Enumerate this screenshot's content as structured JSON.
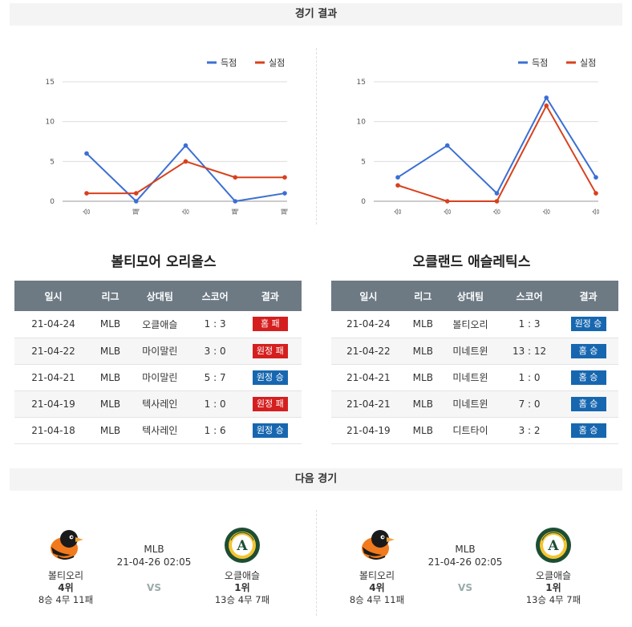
{
  "sections": {
    "results": "경기 결과",
    "next": "다음 경기"
  },
  "legend": {
    "scored": "득점",
    "allowed": "실점"
  },
  "colors": {
    "scored": "#3b6fd4",
    "allowed": "#d8401c",
    "win": "#1767b0",
    "loss": "#d51f1f",
    "header": "#6d7a84"
  },
  "chart_data": [
    {
      "type": "line",
      "categories": [
        "승",
        "패",
        "승",
        "패",
        "패"
      ],
      "ylim": [
        0,
        15
      ],
      "yticks": [
        0,
        5,
        10,
        15
      ],
      "series": [
        {
          "name": "득점",
          "values": [
            6,
            0,
            7,
            0,
            1
          ]
        },
        {
          "name": "실점",
          "values": [
            1,
            1,
            5,
            3,
            3
          ]
        }
      ]
    },
    {
      "type": "line",
      "categories": [
        "승",
        "승",
        "승",
        "승",
        "승"
      ],
      "ylim": [
        0,
        15
      ],
      "yticks": [
        0,
        5,
        10,
        15
      ],
      "series": [
        {
          "name": "득점",
          "values": [
            3,
            7,
            1,
            13,
            3
          ]
        },
        {
          "name": "실점",
          "values": [
            2,
            0,
            0,
            12,
            1
          ]
        }
      ]
    }
  ],
  "columns": [
    "일시",
    "리그",
    "상대팀",
    "스코어",
    "결과"
  ],
  "teams": [
    {
      "title": "볼티모어 오리올스",
      "rows": [
        {
          "date": "21-04-24",
          "league": "MLB",
          "opponent": "오클애슬",
          "score": "1 : 3",
          "result": "홈 패",
          "type": "loss"
        },
        {
          "date": "21-04-22",
          "league": "MLB",
          "opponent": "마이말린",
          "score": "3 : 0",
          "result": "원정 패",
          "type": "loss"
        },
        {
          "date": "21-04-21",
          "league": "MLB",
          "opponent": "마이말린",
          "score": "5 : 7",
          "result": "원정 승",
          "type": "win"
        },
        {
          "date": "21-04-19",
          "league": "MLB",
          "opponent": "텍사레인",
          "score": "1 : 0",
          "result": "원정 패",
          "type": "loss"
        },
        {
          "date": "21-04-18",
          "league": "MLB",
          "opponent": "텍사레인",
          "score": "1 : 6",
          "result": "원정 승",
          "type": "win"
        }
      ]
    },
    {
      "title": "오클랜드 애슬레틱스",
      "rows": [
        {
          "date": "21-04-24",
          "league": "MLB",
          "opponent": "볼티오리",
          "score": "1 : 3",
          "result": "원정 승",
          "type": "win"
        },
        {
          "date": "21-04-22",
          "league": "MLB",
          "opponent": "미네트윈",
          "score": "13 : 12",
          "result": "홈 승",
          "type": "win"
        },
        {
          "date": "21-04-21",
          "league": "MLB",
          "opponent": "미네트윈",
          "score": "1 : 0",
          "result": "홈 승",
          "type": "win"
        },
        {
          "date": "21-04-21",
          "league": "MLB",
          "opponent": "미네트윈",
          "score": "7 : 0",
          "result": "홈 승",
          "type": "win"
        },
        {
          "date": "21-04-19",
          "league": "MLB",
          "opponent": "디트타이",
          "score": "3 : 2",
          "result": "홈 승",
          "type": "win"
        }
      ]
    }
  ],
  "next_games": [
    {
      "home": {
        "name": "볼티오리",
        "rank": "4위",
        "record": "8승 4무 11패",
        "logo": "orioles-bird-icon"
      },
      "away": {
        "name": "오클애슬",
        "rank": "1위",
        "record": "13승 4무 7패",
        "logo": "athletics-badge-icon"
      },
      "league": "MLB",
      "datetime": "21-04-26 02:05",
      "vs": "VS"
    },
    {
      "home": {
        "name": "볼티오리",
        "rank": "4위",
        "record": "8승 4무 11패",
        "logo": "orioles-bird-icon"
      },
      "away": {
        "name": "오클애슬",
        "rank": "1위",
        "record": "13승 4무 7패",
        "logo": "athletics-badge-icon"
      },
      "league": "MLB",
      "datetime": "21-04-26 02:05",
      "vs": "VS"
    }
  ]
}
